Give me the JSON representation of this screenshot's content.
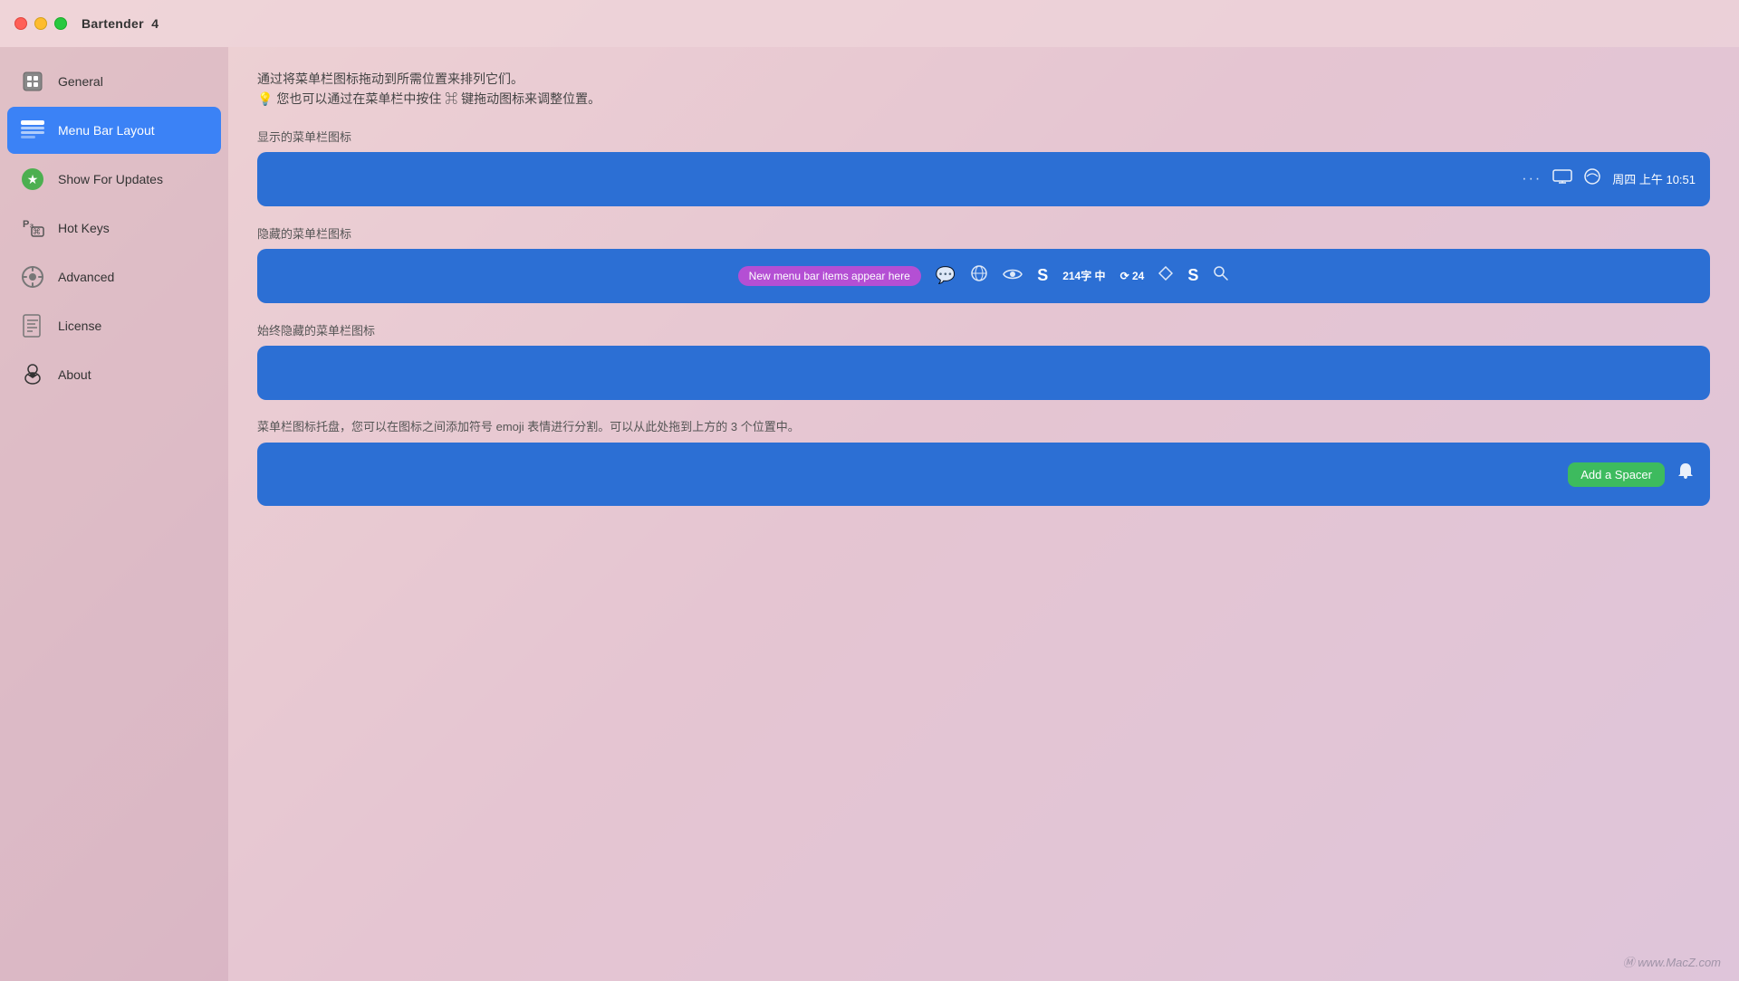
{
  "titlebar": {
    "app_name": "Bartender",
    "version": "4"
  },
  "sidebar": {
    "items": [
      {
        "id": "general",
        "label": "General",
        "icon": "⊟",
        "active": false
      },
      {
        "id": "menu-bar-layout",
        "label": "Menu Bar Layout",
        "icon": "menubar",
        "active": true
      },
      {
        "id": "show-for-updates",
        "label": "Show For Updates",
        "icon": "★",
        "active": false
      },
      {
        "id": "hot-keys",
        "label": "Hot Keys",
        "icon": "hotkeys",
        "active": false
      },
      {
        "id": "advanced",
        "label": "Advanced",
        "icon": "⚙",
        "active": false
      },
      {
        "id": "license",
        "label": "License",
        "icon": "📄",
        "active": false
      },
      {
        "id": "about",
        "label": "About",
        "icon": "🤵",
        "active": false
      }
    ]
  },
  "content": {
    "intro_line1": "通过将菜单栏图标拖动到所需位置来排列它们。",
    "intro_line2": "💡 您也可以通过在菜单栏中按住 ⌘ 键拖动图标来调整位置。",
    "section_shown": "显示的菜单栏图标",
    "section_hidden": "隐藏的菜单栏图标",
    "section_always_hidden": "始终隐藏的菜单栏图标",
    "section_tray": "菜单栏图标托盘，您可以在图标之间添加符号 emoji 表情进行分割。可以从此处拖到上方的 3 个位置中。",
    "new_items_badge": "New menu bar items appear here",
    "time_display": "周四 上午 10:51",
    "add_spacer_label": "Add a Spacer",
    "hidden_zone_icons": [
      "💬",
      "🌐",
      "👁",
      "S",
      "214字 中",
      "⟳ 24",
      "◇",
      "S",
      "🔍"
    ],
    "dots_icon": "···"
  },
  "watermark": "Ⓜ www.MacZ.com"
}
